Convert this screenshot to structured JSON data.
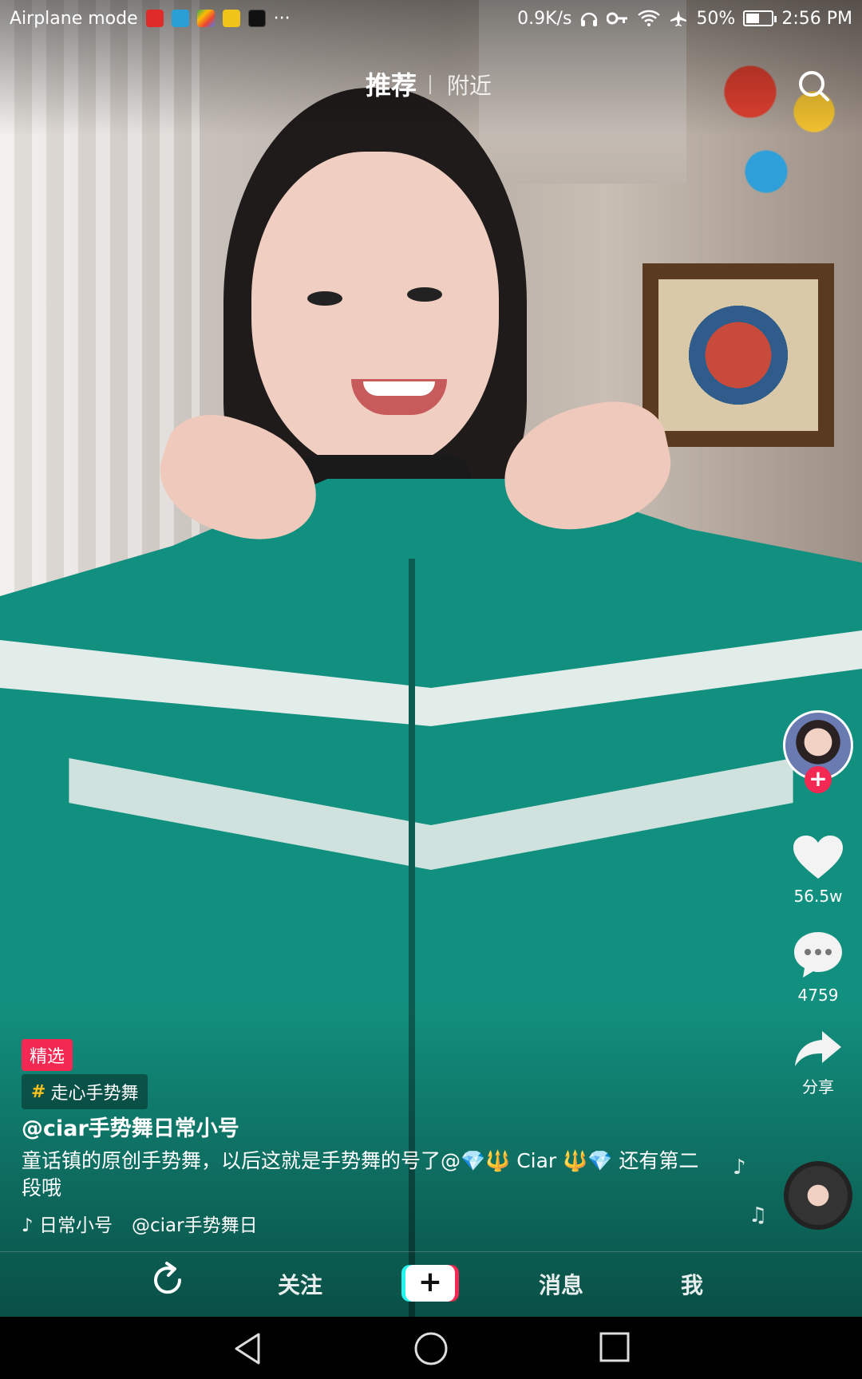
{
  "status_bar": {
    "left_text": "Airplane mode",
    "more": "···",
    "speed": "0.9K/s",
    "battery": "50%",
    "time": "2:56 PM",
    "icons": [
      "netease-music-icon",
      "app-icon",
      "play-store-icon",
      "photos-icon",
      "tiktok-icon",
      "headphones-icon",
      "key-icon",
      "wifi-icon",
      "airplane-icon",
      "battery-icon"
    ]
  },
  "top_tabs": {
    "recommend": "推荐",
    "nearby": "附近"
  },
  "sidebar": {
    "likes": "56.5w",
    "comments": "4759",
    "share": "分享"
  },
  "post": {
    "featured_tag": "精选",
    "topic_hash": "#",
    "topic": "走心手势舞",
    "username": "@ciar手势舞日常小号",
    "description": "童话镇的原创手势舞，以后这就是手势舞的号了@💎🔱 Ciar 🔱💎 还有第二段哦",
    "music_text_1": "♪ 日常小号",
    "music_text_2": "@ciar手势舞日"
  },
  "bottom_nav": {
    "follow": "关注",
    "add": "+",
    "messages": "消息",
    "me": "我"
  },
  "colors": {
    "accent_red": "#f32853",
    "accent_cyan": "#25f4ee",
    "topic_yellow": "#f7c11d",
    "jacket_green": "#12907f"
  }
}
